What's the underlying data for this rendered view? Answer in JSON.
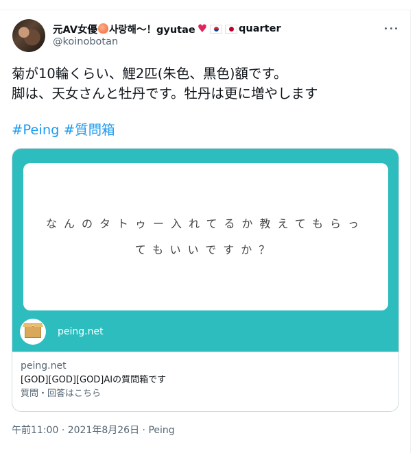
{
  "tweet": {
    "author": {
      "display_name_part1": "元AV女優",
      "display_name_part2": "사랑해〜！gyutae",
      "display_name_part3": "quarter",
      "handle": "@koinobotan"
    },
    "text_line1": "菊が10輪くらい、鯉2匹(朱色、黒色)額です。",
    "text_line2": "脚は、天女さんと牡丹です。牡丹は更に増やします",
    "hashtags": [
      "#Peing",
      "#質問箱"
    ],
    "card": {
      "question": "なんのタトゥー入れてるか教えてもらってもいいですか？",
      "image_domain": "peing.net",
      "domain": "peing.net",
      "title": "[GOD][GOD][GOD]AIの質問箱です",
      "description": "質問・回答はこちら"
    },
    "time": "午前11:00",
    "date": "2021年8月26日",
    "separator": "·",
    "source": "Peing"
  },
  "icons": {
    "more": "more-horizontal-icon",
    "peach": "peach-emoji-icon",
    "heart": "red-heart-emoji-icon",
    "flag_kr": "south-korea-flag-icon",
    "flag_jp": "japan-flag-icon",
    "peing_logo": "cardboard-box-logo"
  },
  "colors": {
    "accent": "#1d9bf0",
    "card_teal": "#2ebdbe",
    "muted_text": "#536471"
  }
}
